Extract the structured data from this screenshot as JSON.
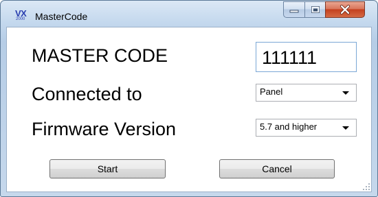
{
  "window": {
    "title": "MasterCode",
    "icon": {
      "top": "VX",
      "bottom": "2000"
    }
  },
  "form": {
    "master_code": {
      "label": "MASTER CODE",
      "value": "111111"
    },
    "connected_to": {
      "label": "Connected to",
      "selected": "Panel"
    },
    "firmware": {
      "label": "Firmware Version",
      "selected": "5.7 and higher"
    }
  },
  "buttons": {
    "start": "Start",
    "cancel": "Cancel"
  },
  "colors": {
    "close_button": "#c4401f",
    "input_border": "#7aa7d6",
    "title_icon": "#2a3fb0"
  }
}
